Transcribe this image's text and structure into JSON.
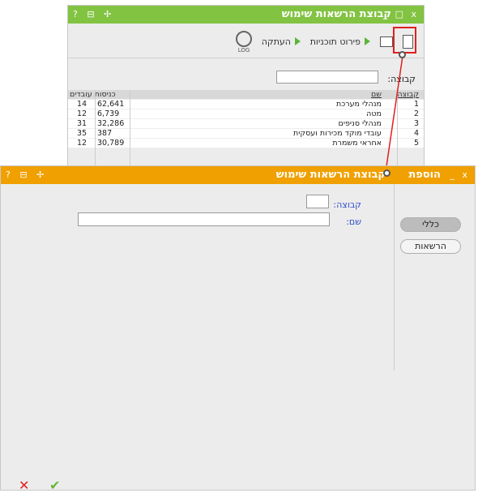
{
  "background_window": {
    "title": "קבוצת הרשאות שימוש",
    "controls": "_ □ x",
    "left_icons": "? ⊟ ✢",
    "toolbar": {
      "breakdown_label": "פירוט תוכניות",
      "copy_label": "העתקה",
      "log_label": "LOG"
    },
    "filter": {
      "label": "קבוצה:",
      "value": ""
    },
    "table": {
      "headers": {
        "id": "קבוצה",
        "name": "שם",
        "logins": "כניסות עובדים"
      },
      "rows": [
        {
          "id": "1",
          "name": "מנהלי מערכת",
          "logins": "62,641",
          "employees": "14"
        },
        {
          "id": "2",
          "name": "מטה",
          "logins": "6,739",
          "employees": "12"
        },
        {
          "id": "3",
          "name": "מנהלי סניפים",
          "logins": "32,286",
          "employees": "31"
        },
        {
          "id": "4",
          "name": "עובדי מוקד מכירות ועסקית",
          "logins": "387",
          "employees": "35"
        },
        {
          "id": "5",
          "name": "אחראי משמרת",
          "logins": "30,789",
          "employees": "12"
        }
      ]
    }
  },
  "foreground_window": {
    "title_prefix": "הוספת",
    "title": "קבוצת הרשאות שימוש",
    "controls": "_ x",
    "left_icons": "? ⊟ ✢",
    "fields": {
      "group_label": "קבוצה:",
      "group_value": "",
      "name_label": "שם:",
      "name_value": ""
    },
    "side_buttons": {
      "general": "כללי",
      "permissions": "הרשאות"
    },
    "footer": {
      "cancel_icon": "✕",
      "ok_icon": "✔"
    }
  },
  "colors": {
    "bg_titlebar": "#82c342",
    "fg_titlebar": "#f0a000",
    "highlight": "#e02020",
    "label_blue": "#3050c8",
    "ok_green": "#6bb536"
  }
}
